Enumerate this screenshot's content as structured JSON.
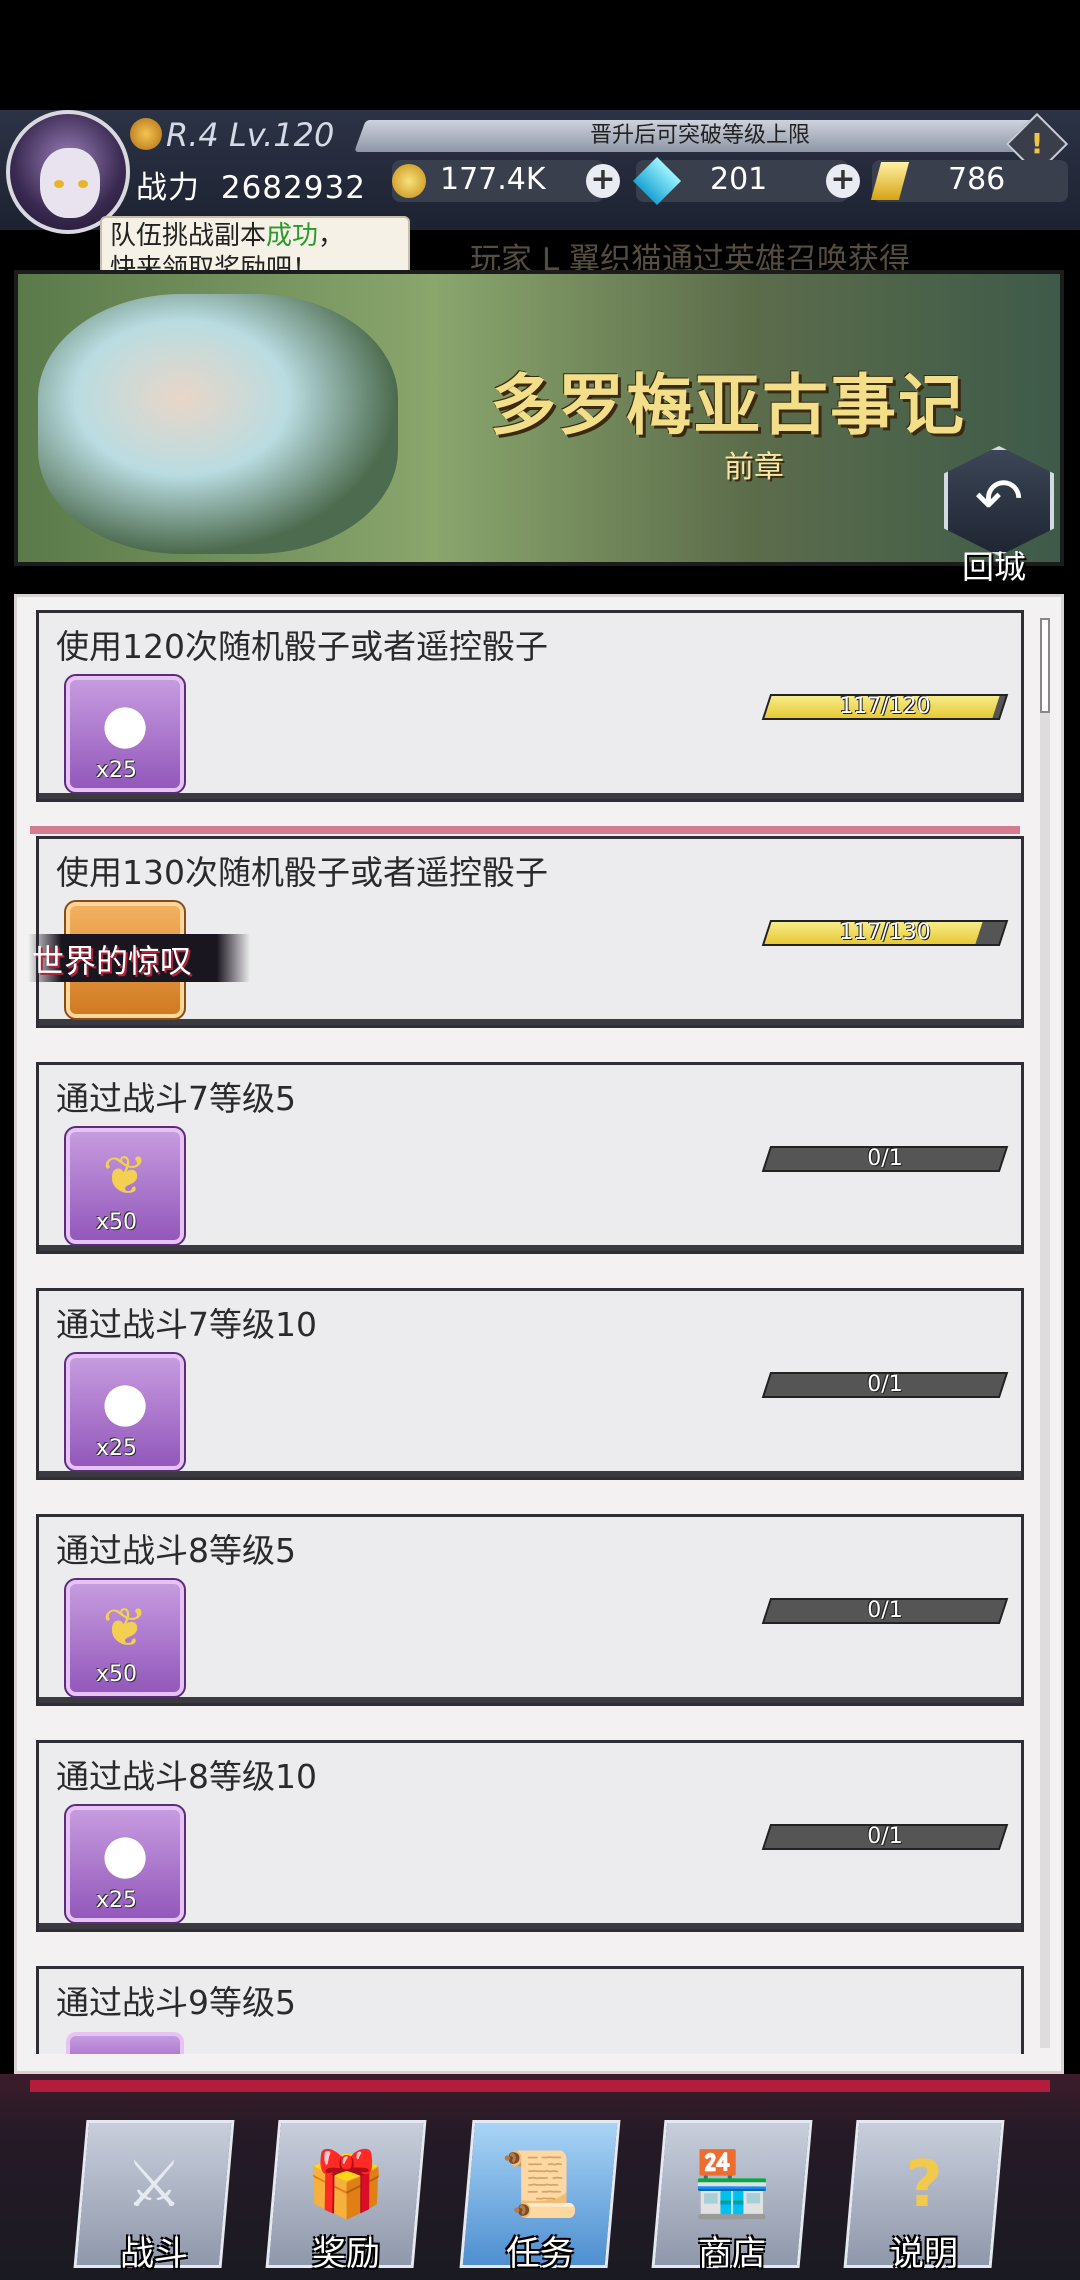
{
  "header": {
    "rank_level": "R.4 Lv.120",
    "power_label": "战力",
    "power_value": "2682932",
    "notice": "晋升后可突破等级上限",
    "warning_mark": "!",
    "gold": "177.4K",
    "gems": "201",
    "crystals": "786",
    "plus_symbol": "+"
  },
  "bubble": {
    "line1_prefix": "队伍挑战副本",
    "line1_highlight": "成功",
    "line1_suffix": "，",
    "line2": "快来领取奖励吧！"
  },
  "ticker": "玩家 L 翼织猫通过英雄召唤获得",
  "banner": {
    "title": "多罗梅亚古事记",
    "subtitle": "前章",
    "back_icon": "↶",
    "back_label": "回城"
  },
  "quests": [
    {
      "title": "使用120次随机骰子或者遥控骰子",
      "item_icon": "dice-charm",
      "qty": "x25",
      "progress_text": "117/120",
      "progress": 0.975
    },
    {
      "title": "使用130次随机骰子或者遥控骰子",
      "item_icon": "title-badge",
      "qty": "",
      "badge_text": "世界的惊叹",
      "progress_text": "117/130",
      "progress": 0.9
    },
    {
      "title": "通过战斗7等级5",
      "item_icon": "wheat",
      "qty": "x50",
      "progress_text": "0/1",
      "progress": 0
    },
    {
      "title": "通过战斗7等级10",
      "item_icon": "dice-charm",
      "qty": "x25",
      "progress_text": "0/1",
      "progress": 0
    },
    {
      "title": "通过战斗8等级5",
      "item_icon": "wheat",
      "qty": "x50",
      "progress_text": "0/1",
      "progress": 0
    },
    {
      "title": "通过战斗8等级10",
      "item_icon": "dice-charm",
      "qty": "x25",
      "progress_text": "0/1",
      "progress": 0
    },
    {
      "title": "通过战斗9等级5",
      "item_icon": "dice-charm",
      "qty": "",
      "progress_text": "",
      "progress": 0
    }
  ],
  "nav": [
    {
      "label": "战斗",
      "icon": "crossed-swords-icon",
      "active": false
    },
    {
      "label": "奖励",
      "icon": "gift-box-icon",
      "active": false
    },
    {
      "label": "任务",
      "icon": "scroll-icon",
      "active": true
    },
    {
      "label": "商店",
      "icon": "shop-icon",
      "active": false
    },
    {
      "label": "说明",
      "icon": "question-icon",
      "active": false
    }
  ]
}
